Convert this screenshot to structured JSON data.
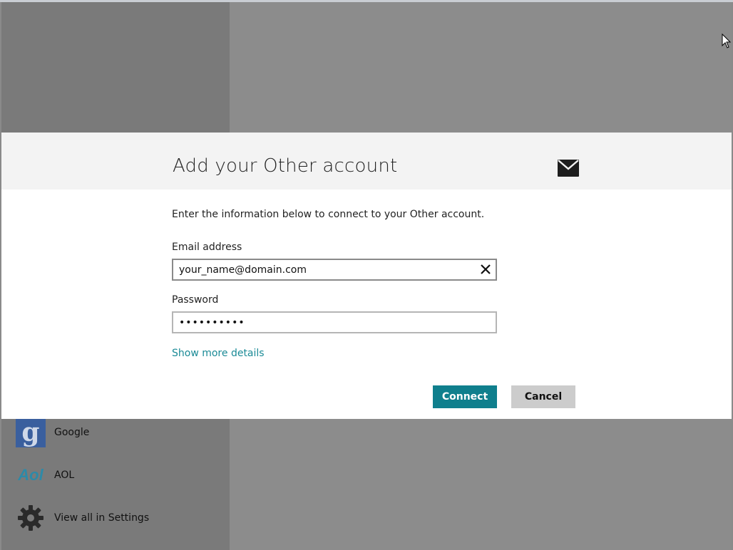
{
  "background": {
    "accounts": [
      {
        "label": "Google",
        "icon": "google-logo-icon"
      },
      {
        "label": "AOL",
        "icon": "aol-logo-icon"
      },
      {
        "label": "View all in Settings",
        "icon": "gear-icon"
      }
    ],
    "google_logo_glyph": "g",
    "aol_logo_glyph": "Aol"
  },
  "dialog": {
    "title": "Add your Other account",
    "icon": "mail-icon",
    "intro": "Enter the information below to connect to your Other account.",
    "email": {
      "label": "Email address",
      "value": "your_name@domain.com"
    },
    "password": {
      "label": "Password",
      "value": "••••••••••"
    },
    "show_more": "Show more details",
    "connect_label": "Connect",
    "cancel_label": "Cancel"
  },
  "colors": {
    "accent": "#0f7f8d",
    "link": "#1a8a96",
    "cancel": "#cccccc"
  }
}
